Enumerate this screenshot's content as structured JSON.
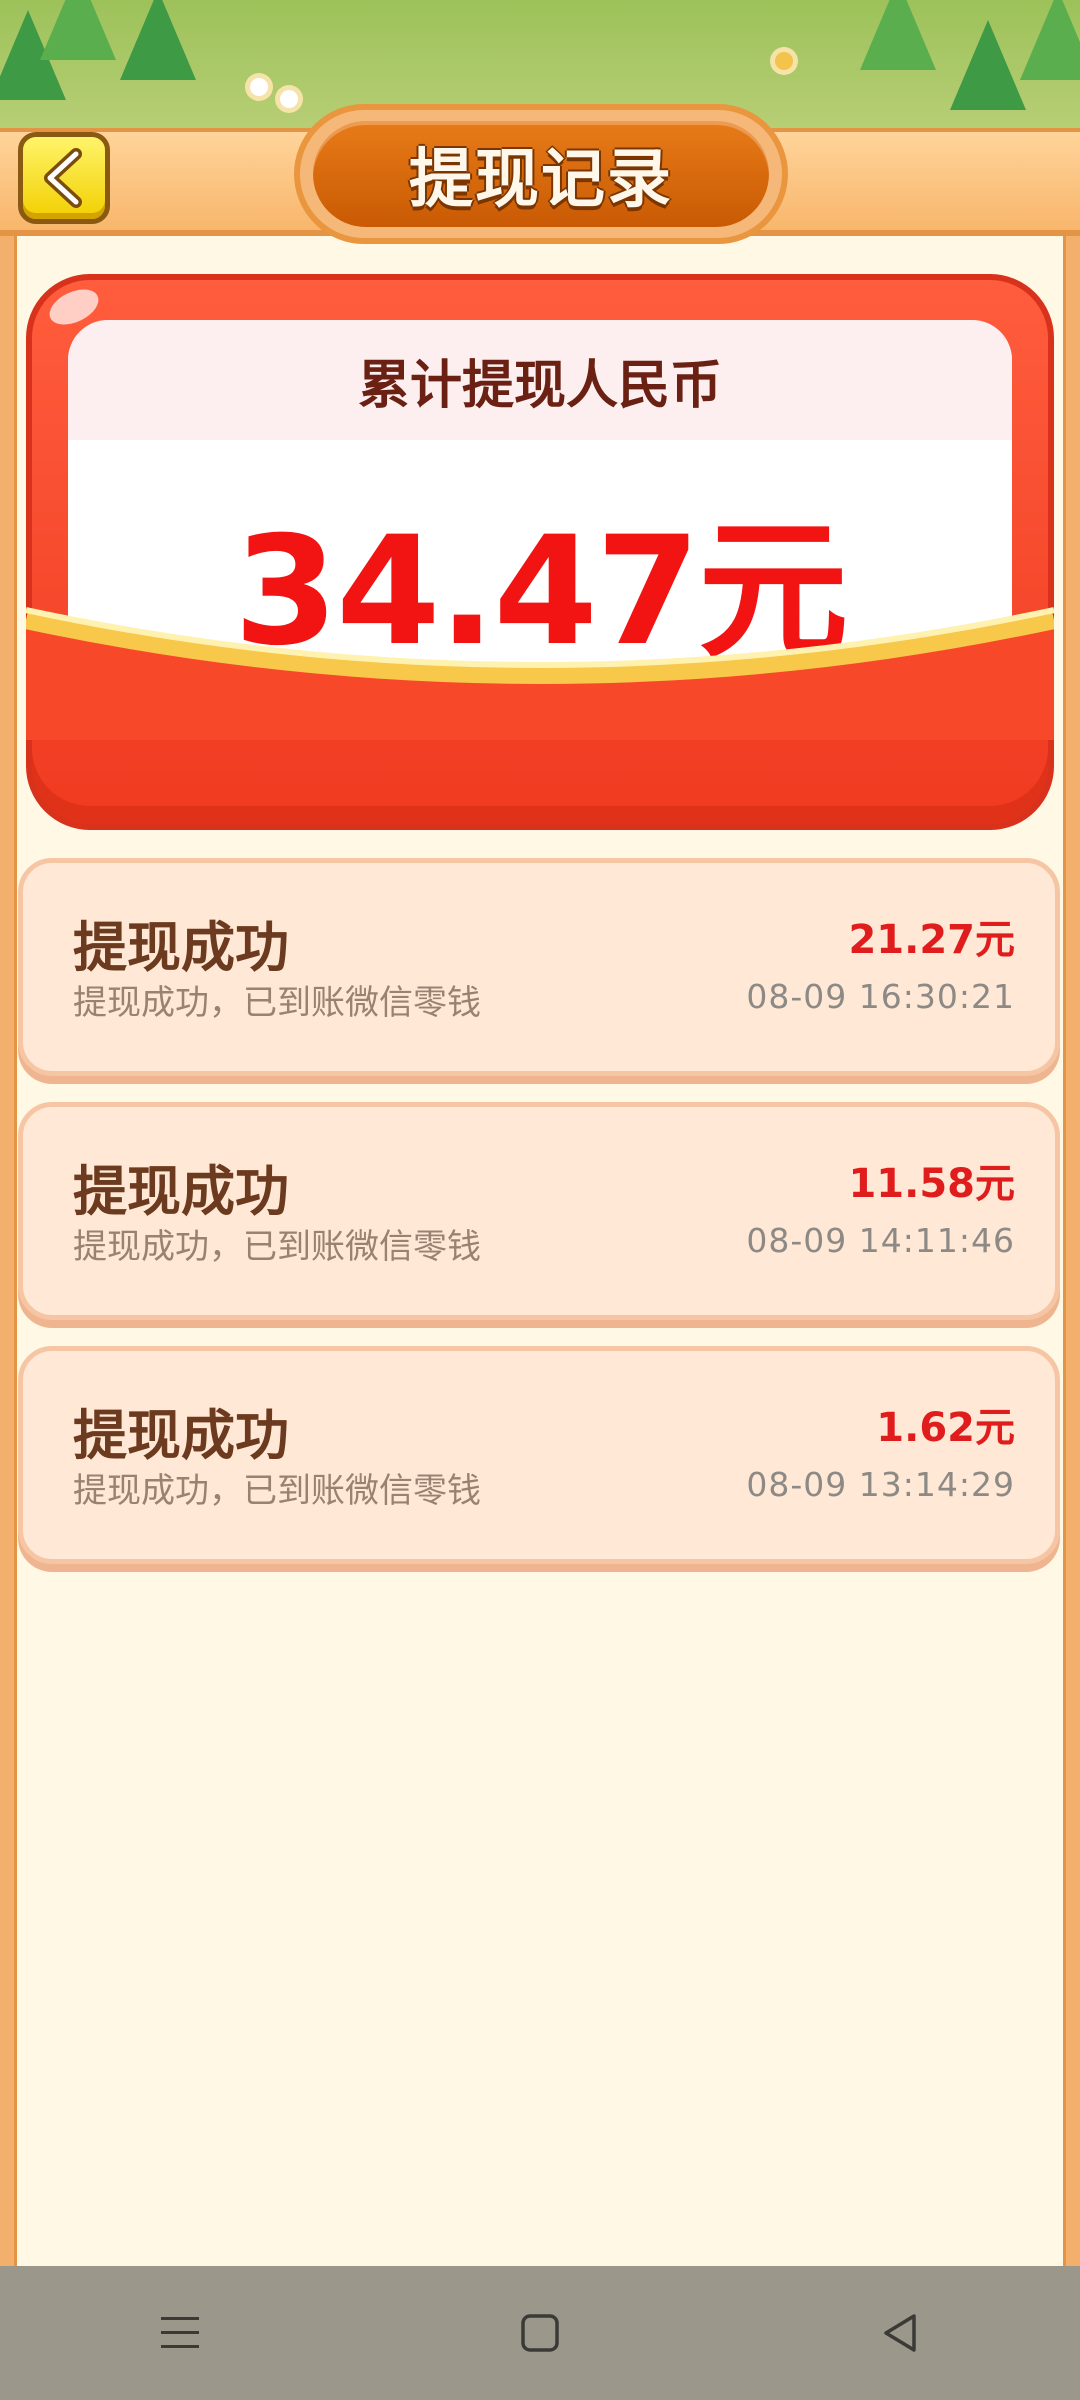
{
  "header": {
    "title": "提现记录",
    "back_icon": "chevron-left-icon"
  },
  "summary": {
    "label": "累计提现人民币",
    "amount": "34.47元"
  },
  "records": [
    {
      "title": "提现成功",
      "desc": "提现成功，已到账微信零钱",
      "amount": "21.27元",
      "time": "08-09  16:30:21"
    },
    {
      "title": "提现成功",
      "desc": "提现成功，已到账微信零钱",
      "amount": "11.58元",
      "time": "08-09  14:11:46"
    },
    {
      "title": "提现成功",
      "desc": "提现成功，已到账微信零钱",
      "amount": "1.62元",
      "time": "08-09  13:14:29"
    }
  ],
  "system_nav": {
    "menu_icon": "menu-icon",
    "home_icon": "home-square-icon",
    "back_icon": "back-triangle-icon"
  },
  "colors": {
    "accent_red": "#f21313",
    "header_orange": "#e87b18",
    "page_bg": "#fff8e4"
  }
}
